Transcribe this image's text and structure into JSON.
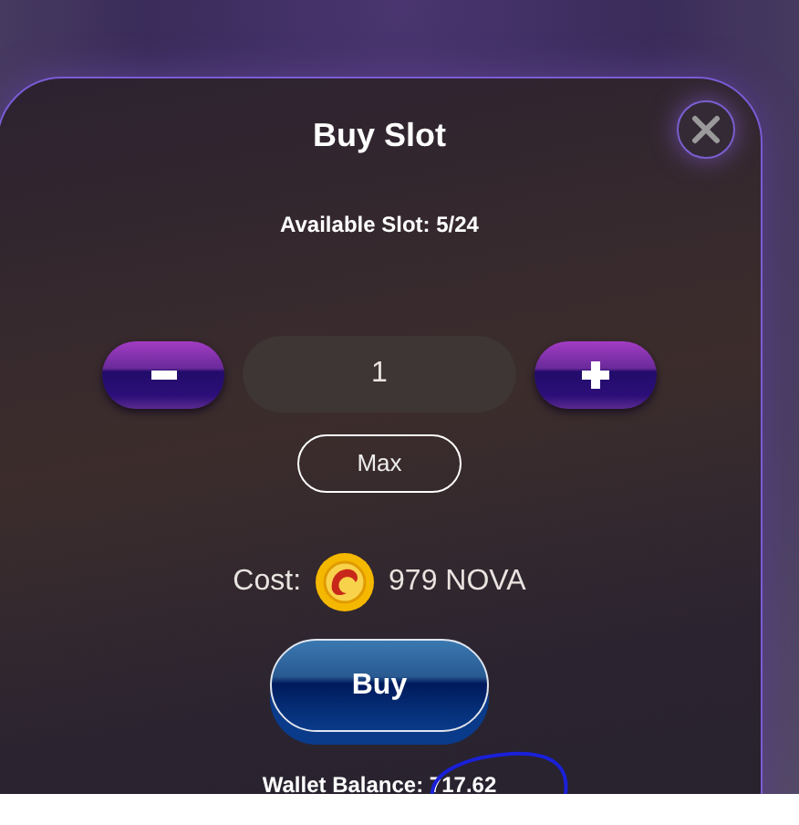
{
  "dialog": {
    "title": "Buy Slot",
    "available": "Available Slot: 5/24",
    "quantity": {
      "value": "1"
    },
    "max_button": "Max",
    "cost": {
      "label": "Cost:",
      "amount": "979 NOVA"
    },
    "buy_button": "Buy",
    "wallet_balance": "Wallet Balance: 717.62"
  }
}
